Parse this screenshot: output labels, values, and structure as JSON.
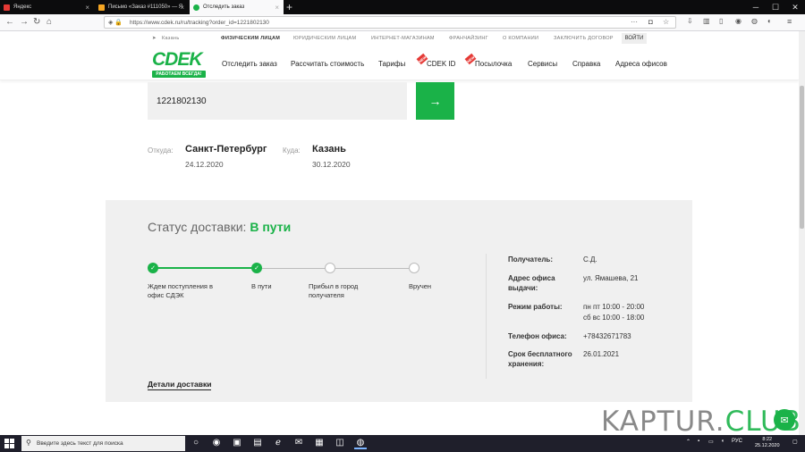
{
  "browser": {
    "tabs": [
      {
        "title": "Яндекс"
      },
      {
        "title": "Письмо «Заказ #111050» — Я"
      },
      {
        "title": "Отследить заказ"
      }
    ],
    "url": "https://www.cdek.ru/ru/tracking?order_id=1221802130"
  },
  "site": {
    "city": "Казань",
    "top_menu": [
      "ФИЗИЧЕСКИМ ЛИЦАМ",
      "ЮРИДИЧЕСКИМ ЛИЦАМ",
      "ИНТЕРНЕТ-МАГАЗИНАМ",
      "ФРАНЧАЙЗИНГ",
      "О КОМПАНИИ",
      "ЗАКЛЮЧИТЬ ДОГОВОР"
    ],
    "login": "ВОЙТИ",
    "logo": {
      "text": "CDEK",
      "tagline": "РАБОТАЕМ ВСЕГДА!"
    },
    "main_menu": [
      "Отследить заказ",
      "Рассчитать стоимость",
      "Тарифы",
      "CDEK ID",
      "Посылочка",
      "Сервисы",
      "Справка",
      "Адреса офисов"
    ],
    "badge": "NEW"
  },
  "tracking": {
    "order_number": "1221802130",
    "from_label": "Откуда:",
    "from_city": "Санкт-Петербург",
    "from_date": "24.12.2020",
    "to_label": "Куда:",
    "to_city": "Казань",
    "to_date": "30.12.2020"
  },
  "status": {
    "title": "Статус доставки:",
    "value": "В пути",
    "steps": [
      {
        "label": "Ждем поступления в офис СДЭК",
        "done": true
      },
      {
        "label": "В пути",
        "done": true
      },
      {
        "label": "Прибыл в город получателя",
        "done": false
      },
      {
        "label": "Вручен",
        "done": false
      }
    ],
    "info": [
      {
        "key": "Получатель:",
        "value": "С.Д."
      },
      {
        "key": "Адрес офиса выдачи:",
        "value": "ул. Ямашева, 21"
      },
      {
        "key": "Режим работы:",
        "value": "пн пт 10:00 - 20:00",
        "value2": "сб вс 10:00 - 18:00"
      },
      {
        "key": "Телефон офиса:",
        "value": "+78432671783"
      },
      {
        "key": "Срок бесплатного хранения:",
        "value": "26.01.2021"
      }
    ],
    "details_link": "Детали доставки"
  },
  "watermark": {
    "part1": "KAPTUR.",
    "part2": "CLUB"
  },
  "taskbar": {
    "search_placeholder": "Введите здесь текст для поиска",
    "lang": "РУС",
    "time": "8:22",
    "date": "25.12.2020"
  },
  "colors": {
    "brand_green": "#1ab248"
  }
}
